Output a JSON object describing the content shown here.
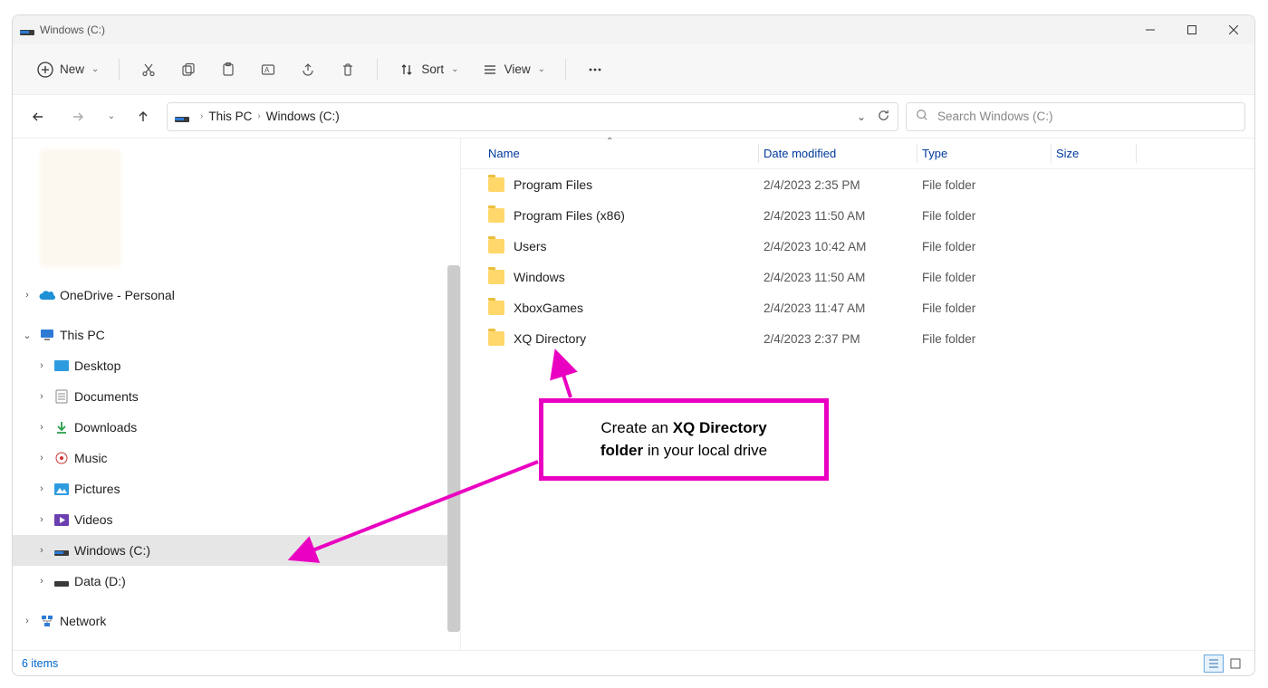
{
  "window": {
    "title": "Windows (C:)"
  },
  "toolbar": {
    "new": "New",
    "sort": "Sort",
    "view": "View"
  },
  "breadcrumb": {
    "root": "This PC",
    "current": "Windows (C:)"
  },
  "search": {
    "placeholder": "Search Windows (C:)"
  },
  "sidebar": {
    "onedrive": "OneDrive - Personal",
    "thispc": "This PC",
    "desktop": "Desktop",
    "documents": "Documents",
    "downloads": "Downloads",
    "music": "Music",
    "pictures": "Pictures",
    "videos": "Videos",
    "drive_c": "Windows (C:)",
    "drive_d": "Data (D:)",
    "network": "Network"
  },
  "columns": {
    "name": "Name",
    "date": "Date modified",
    "type": "Type",
    "size": "Size"
  },
  "rows": [
    {
      "name": "Program Files",
      "date": "2/4/2023 2:35 PM",
      "type": "File folder"
    },
    {
      "name": "Program Files (x86)",
      "date": "2/4/2023 11:50 AM",
      "type": "File folder"
    },
    {
      "name": "Users",
      "date": "2/4/2023 10:42 AM",
      "type": "File folder"
    },
    {
      "name": "Windows",
      "date": "2/4/2023 11:50 AM",
      "type": "File folder"
    },
    {
      "name": "XboxGames",
      "date": "2/4/2023 11:47 AM",
      "type": "File folder"
    },
    {
      "name": "XQ Directory",
      "date": "2/4/2023 2:37 PM",
      "type": "File folder"
    }
  ],
  "status": {
    "items": "6 items"
  },
  "annotation": {
    "line1a": "Create an ",
    "line1b": "XQ Directory",
    "line2a": "folder",
    "line2b": " in your local drive"
  }
}
